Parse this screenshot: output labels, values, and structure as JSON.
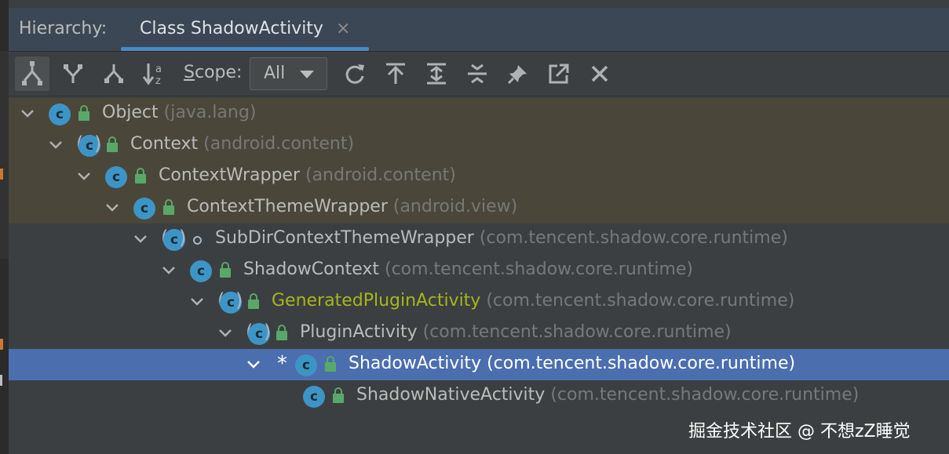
{
  "window": {
    "hierarchy_label": "Hierarchy:",
    "tab_title": "Class ShadowActivity",
    "tab_close": "×"
  },
  "toolbar": {
    "buttons": [
      {
        "name": "class-hierarchy-button",
        "icon": "subtypes-hierarchy-icon",
        "active": true
      },
      {
        "name": "supertypes-hierarchy-button",
        "icon": "supertypes-hierarchy-icon"
      },
      {
        "name": "subtypes-hierarchy-button",
        "icon": "subtypes-icon"
      },
      {
        "name": "sort-alphabetically-button",
        "icon": "sort-alpha-icon"
      }
    ],
    "scope_label_prefix": "S",
    "scope_label_rest": "cope:",
    "scope_value": "All",
    "actions": [
      {
        "name": "refresh-button",
        "icon": "refresh-icon"
      },
      {
        "name": "base-on-class-button",
        "icon": "arrow-up-to-bar-icon"
      },
      {
        "name": "expand-all-button",
        "icon": "expand-all-icon"
      },
      {
        "name": "collapse-all-button",
        "icon": "collapse-all-icon"
      },
      {
        "name": "pin-button",
        "icon": "pin-icon"
      },
      {
        "name": "export-button",
        "icon": "export-icon"
      },
      {
        "name": "close-button",
        "icon": "close-icon"
      }
    ]
  },
  "tree": [
    {
      "name": "Object",
      "pkg": " (java.lang)",
      "expanded": true,
      "abstract": false,
      "access": "public",
      "library": true
    },
    {
      "name": "Context",
      "pkg": " (android.content)",
      "expanded": true,
      "abstract": true,
      "access": "public",
      "library": true
    },
    {
      "name": "ContextWrapper",
      "pkg": " (android.content)",
      "expanded": true,
      "abstract": false,
      "access": "public",
      "library": true
    },
    {
      "name": "ContextThemeWrapper",
      "pkg": " (android.view)",
      "expanded": true,
      "abstract": false,
      "access": "public",
      "library": true
    },
    {
      "name": "SubDirContextThemeWrapper",
      "pkg": " (com.tencent.shadow.core.runtime)",
      "expanded": true,
      "abstract": true,
      "access": "package"
    },
    {
      "name": "ShadowContext",
      "pkg": " (com.tencent.shadow.core.runtime)",
      "expanded": true,
      "abstract": false,
      "access": "public"
    },
    {
      "name": "GeneratedPluginActivity",
      "pkg": " (com.tencent.shadow.core.runtime)",
      "expanded": true,
      "abstract": true,
      "access": "public",
      "generated": true
    },
    {
      "name": "PluginActivity",
      "pkg": " (com.tencent.shadow.core.runtime)",
      "expanded": true,
      "abstract": true,
      "access": "public"
    },
    {
      "name": "ShadowActivity",
      "pkg": " (com.tencent.shadow.core.runtime)",
      "expanded": true,
      "abstract": false,
      "access": "public",
      "selected": true,
      "marker": "*"
    },
    {
      "name": "ShadowNativeActivity",
      "pkg": " (com.tencent.shadow.core.runtime)",
      "expanded": false,
      "abstract": false,
      "access": "public"
    }
  ],
  "class_icon_letter": "c",
  "watermark": "掘金技术社区 @ 不想zZ睡觉",
  "colors": {
    "selection": "#4b6eaf",
    "library_bg": "#4a473a",
    "class_icon": "#3d94c6",
    "access_green": "#59a869",
    "generated_text": "#a8b51a"
  }
}
